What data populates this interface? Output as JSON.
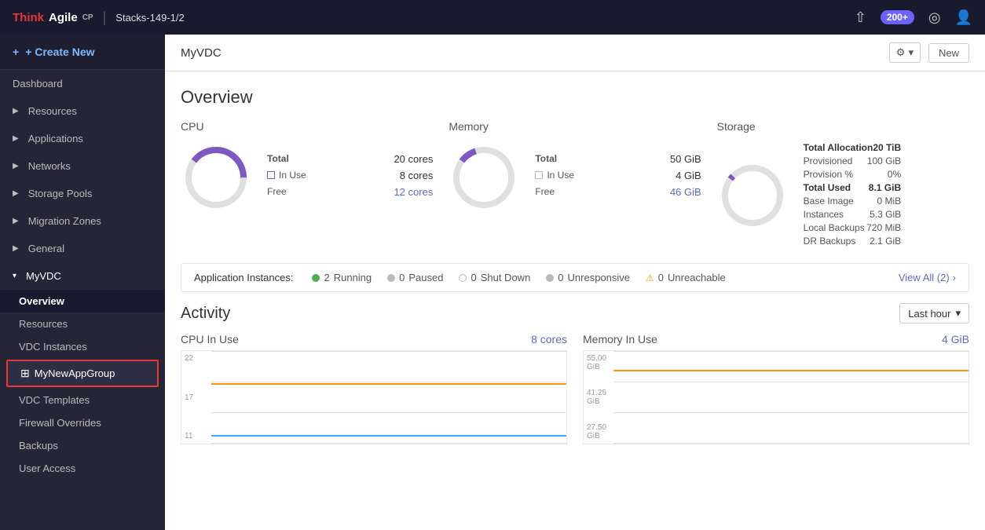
{
  "topnav": {
    "brand_think": "Think",
    "brand_agile": "Agile",
    "brand_cp": "CP",
    "stack": "Stacks-149-1/2",
    "badge": "200+",
    "icons": [
      "upload-icon",
      "bell-icon",
      "globe-icon",
      "user-icon"
    ]
  },
  "sidebar": {
    "create_new": "+ Create New",
    "items": [
      {
        "label": "Dashboard",
        "id": "dashboard"
      },
      {
        "label": "Resources",
        "id": "resources",
        "arrow": "▶"
      },
      {
        "label": "Applications",
        "id": "applications",
        "arrow": "▶"
      },
      {
        "label": "Networks",
        "id": "networks",
        "arrow": "▶"
      },
      {
        "label": "Storage Pools",
        "id": "storage-pools",
        "arrow": "▶"
      },
      {
        "label": "Migration Zones",
        "id": "migration-zones",
        "arrow": "▶"
      },
      {
        "label": "General",
        "id": "general",
        "arrow": "▶"
      },
      {
        "label": "MyVDC",
        "id": "myvdc",
        "arrow": "▾"
      }
    ],
    "sub_items": [
      {
        "label": "Overview",
        "id": "overview",
        "active": true
      },
      {
        "label": "Resources",
        "id": "vdc-resources"
      },
      {
        "label": "VDC Instances",
        "id": "vdc-instances"
      },
      {
        "label": "MyNewAppGroup",
        "id": "mynewappgroup",
        "highlight": true
      },
      {
        "label": "VDC Templates",
        "id": "vdc-templates"
      },
      {
        "label": "Firewall Overrides",
        "id": "firewall-overrides"
      },
      {
        "label": "Backups",
        "id": "backups"
      },
      {
        "label": "User Access",
        "id": "user-access"
      }
    ]
  },
  "page": {
    "title": "MyVDC",
    "gear_label": "⚙",
    "new_label": "New"
  },
  "overview": {
    "title": "Overview",
    "cpu": {
      "label": "CPU",
      "total_label": "Total",
      "total_value": "20 cores",
      "in_use_label": "In Use",
      "in_use_value": "8 cores",
      "free_label": "Free",
      "free_value": "12 cores",
      "percent_used": 40
    },
    "memory": {
      "label": "Memory",
      "total_label": "Total",
      "total_value": "50 GiB",
      "in_use_label": "In Use",
      "in_use_value": "4 GiB",
      "free_label": "Free",
      "free_value": "46 GiB",
      "percent_used": 8
    },
    "storage": {
      "label": "Storage",
      "rows": [
        {
          "label": "Total Allocation",
          "value": "20 TiB",
          "bold": true
        },
        {
          "label": "Provisioned",
          "value": "100 GiB",
          "bold": false
        },
        {
          "label": "Provision %",
          "value": "0%",
          "bold": false
        },
        {
          "label": "Total Used",
          "value": "8.1 GiB",
          "bold": true
        },
        {
          "label": "Base Image",
          "value": "0 MiB",
          "bold": false
        },
        {
          "label": "Instances",
          "value": "5.3 GiB",
          "bold": false
        },
        {
          "label": "Local Backups",
          "value": "720 MiB",
          "bold": false
        },
        {
          "label": "DR Backups",
          "value": "2.1 GiB",
          "bold": false
        }
      ]
    }
  },
  "instances_bar": {
    "label": "Application Instances:",
    "running_count": "2",
    "running_label": "Running",
    "paused_count": "0",
    "paused_label": "Paused",
    "shutdown_count": "0",
    "shutdown_label": "Shut Down",
    "unresponsive_count": "0",
    "unresponsive_label": "Unresponsive",
    "unreachable_count": "0",
    "unreachable_label": "Unreachable",
    "view_all": "View All (2)"
  },
  "activity": {
    "title": "Activity",
    "time_select": "Last hour",
    "cpu_label": "CPU In Use",
    "cpu_value": "8 cores",
    "memory_label": "Memory In Use",
    "memory_value": "4 GiB",
    "cpu_y_labels": [
      "22",
      "17",
      "11"
    ],
    "memory_y_labels": [
      "55.00 GiB",
      "41.25 GiB",
      "27.50 GiB"
    ]
  }
}
